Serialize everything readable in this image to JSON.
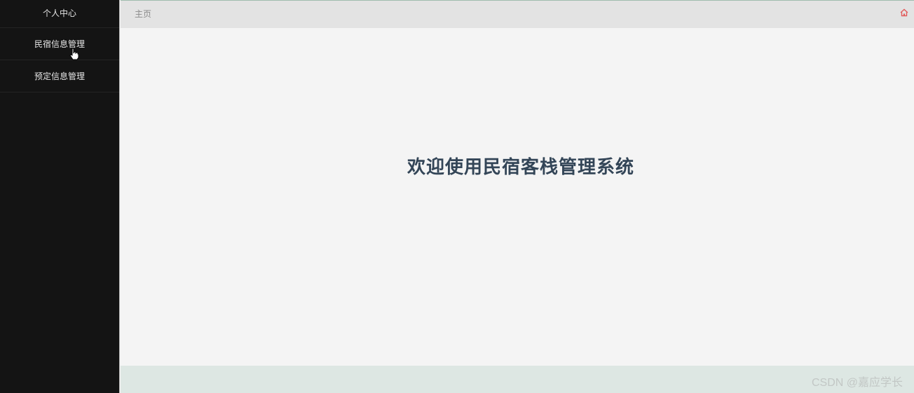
{
  "sidebar": {
    "items": [
      {
        "label": "个人中心"
      },
      {
        "label": "民宿信息管理"
      },
      {
        "label": "预定信息管理"
      }
    ]
  },
  "header": {
    "breadcrumb": "主页",
    "home_icon": "home-icon"
  },
  "main": {
    "welcome_title": "欢迎使用民宿客栈管理系统"
  },
  "footer": {
    "watermark": "CSDN @嘉应学长"
  },
  "colors": {
    "sidebar_bg": "#141414",
    "topbar_bg": "#e3e3e3",
    "content_bg": "#f4f4f4",
    "title_text": "#334557",
    "footer_bg": "#dde7e3",
    "home_icon": "#e25b5b"
  }
}
